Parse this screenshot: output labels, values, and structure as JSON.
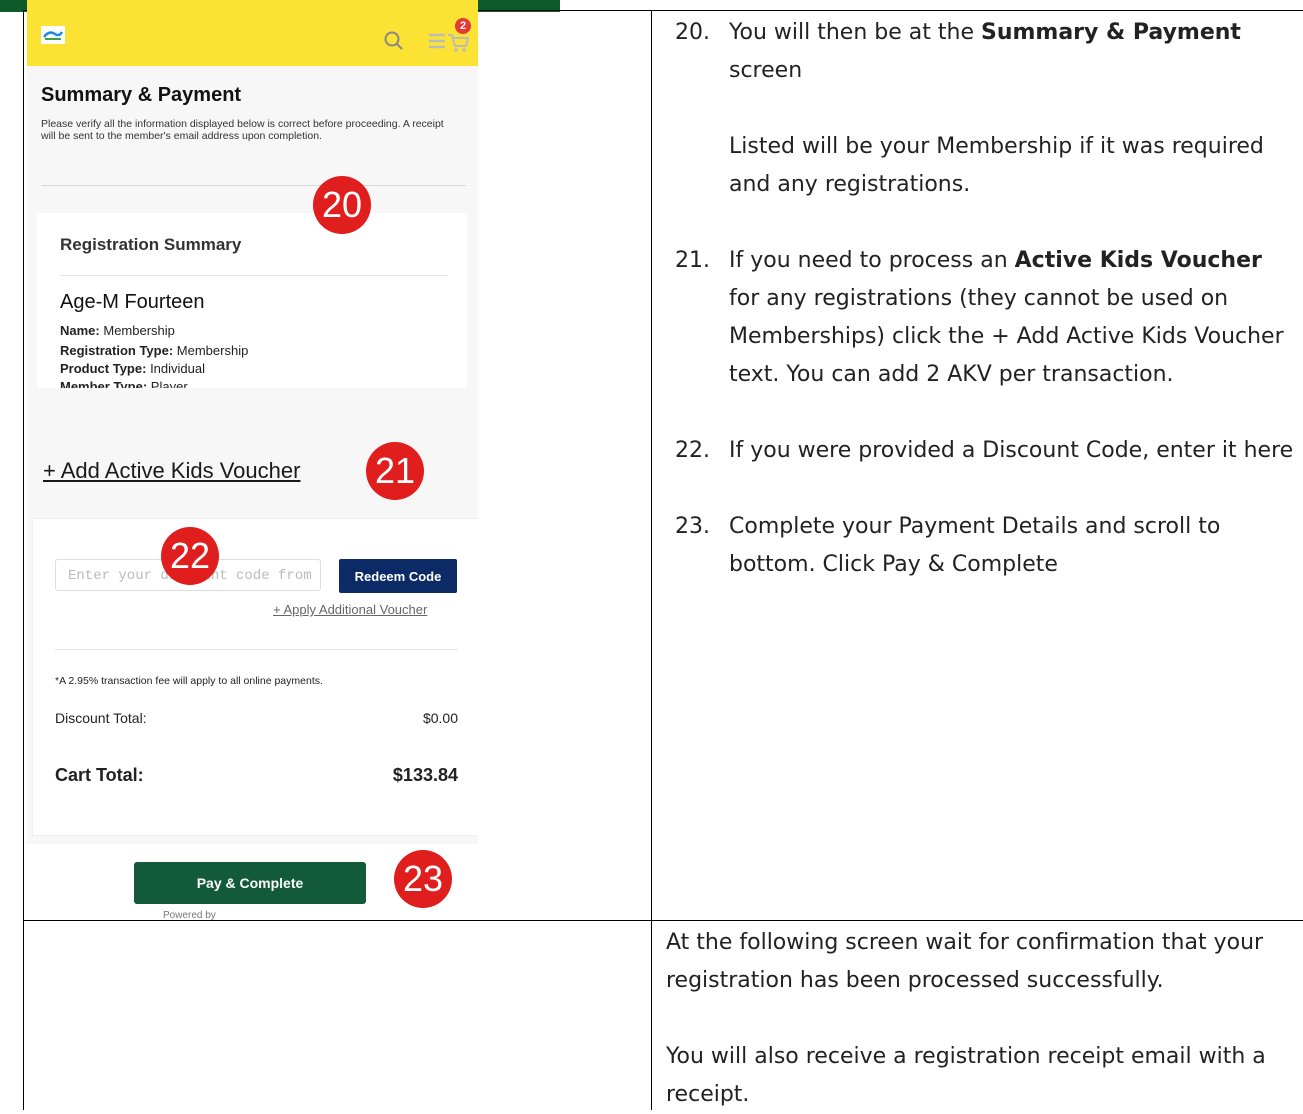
{
  "screenshot": {
    "header": {
      "cart_count": "2"
    },
    "title": "Summary & Payment",
    "description": "Please verify all the information displayed below is correct before proceeding.  A receipt will be sent to the member's email address upon completion.",
    "registration_summary": {
      "heading": "Registration Summary",
      "member_name": "Age-M Fourteen",
      "lines": [
        {
          "label": "Name:",
          "value": "Membership"
        },
        {
          "label": "Registration Type:",
          "value": "Membership"
        },
        {
          "label": "Product Type:",
          "value": "Individual"
        },
        {
          "label": "Member Type:",
          "value": "Player"
        }
      ]
    },
    "akv_link": "+ Add Active Kids Voucher",
    "discount": {
      "input_value": "Enter your discount code from our total checkout",
      "redeem_label": "Redeem Code",
      "apply_additional": "+ Apply Additional Voucher"
    },
    "fee_note": "*A 2.95% transaction fee will apply to all online payments.",
    "discount_total_label": "Discount Total:",
    "discount_total_value": "$0.00",
    "cart_total_label": "Cart Total:",
    "cart_total_value": "$133.84",
    "pay_label": "Pay & Complete",
    "powered_by": "Powered by"
  },
  "callouts": [
    "20",
    "21",
    "22",
    "23"
  ],
  "instructions": {
    "step20": {
      "num": "20.",
      "lead": "You will then be at the ",
      "bold": "Summary & Payment",
      "tail": " screen",
      "extra": "Listed will be your Membership if it was required and any registrations."
    },
    "step21": {
      "num": "21.",
      "lead": "If you need to process an ",
      "bold": "Active Kids Voucher",
      "tail": " for any registrations (they cannot be used on Memberships) click the + Add Active Kids Voucher text.  You can add 2 AKV per transaction."
    },
    "step22": {
      "num": "22.",
      "text": "If you were provided a Discount Code, enter it here"
    },
    "step23": {
      "num": "23.",
      "text": "Complete your Payment Details and scroll to bottom.  Click Pay & Complete"
    }
  },
  "bottom": {
    "para1": "At the following screen wait for confirmation that your registration has been processed successfully.",
    "para2": "You will also receive a registration receipt email with a receipt."
  },
  "colors": {
    "app_yellow": "#fbe233",
    "pay_green": "#125a3a",
    "redeem_navy": "#0b2a66",
    "callout_red": "#e01e1e",
    "header_band_green": "#0f5a2a"
  }
}
